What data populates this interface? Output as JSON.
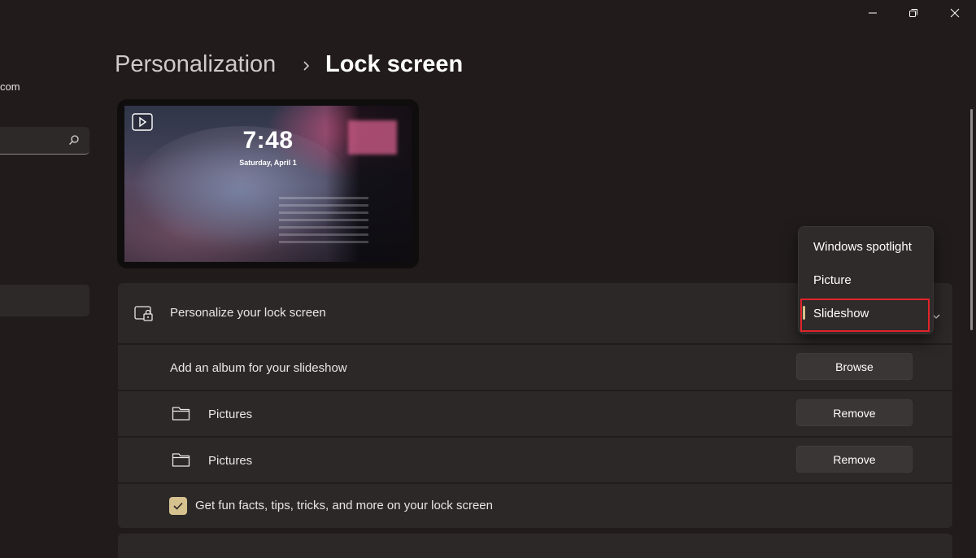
{
  "window": {
    "controls": [
      "minimize",
      "restore",
      "close"
    ]
  },
  "sidebar": {
    "account_fragment": "com"
  },
  "breadcrumb": {
    "parent": "Personalization",
    "separator": "›",
    "current": "Lock screen"
  },
  "preview": {
    "time": "7:48",
    "date": "Saturday, April 1"
  },
  "settings": {
    "personalize_label": "Personalize your lock screen",
    "album_label": "Add an album for your slideshow",
    "browse_label": "Browse",
    "folders": [
      {
        "name": "Pictures",
        "remove_label": "Remove"
      },
      {
        "name": "Pictures",
        "remove_label": "Remove"
      }
    ],
    "fun_facts": {
      "label": "Get fun facts, tips, tricks, and more on your lock screen",
      "checked": true
    }
  },
  "dropdown": {
    "options": [
      "Windows spotlight",
      "Picture",
      "Slideshow"
    ],
    "selected": "Slideshow"
  },
  "colors": {
    "accent": "#d6c28f",
    "highlight_box": "#e0242a",
    "background": "#211c1b",
    "card": "#2c2827"
  }
}
